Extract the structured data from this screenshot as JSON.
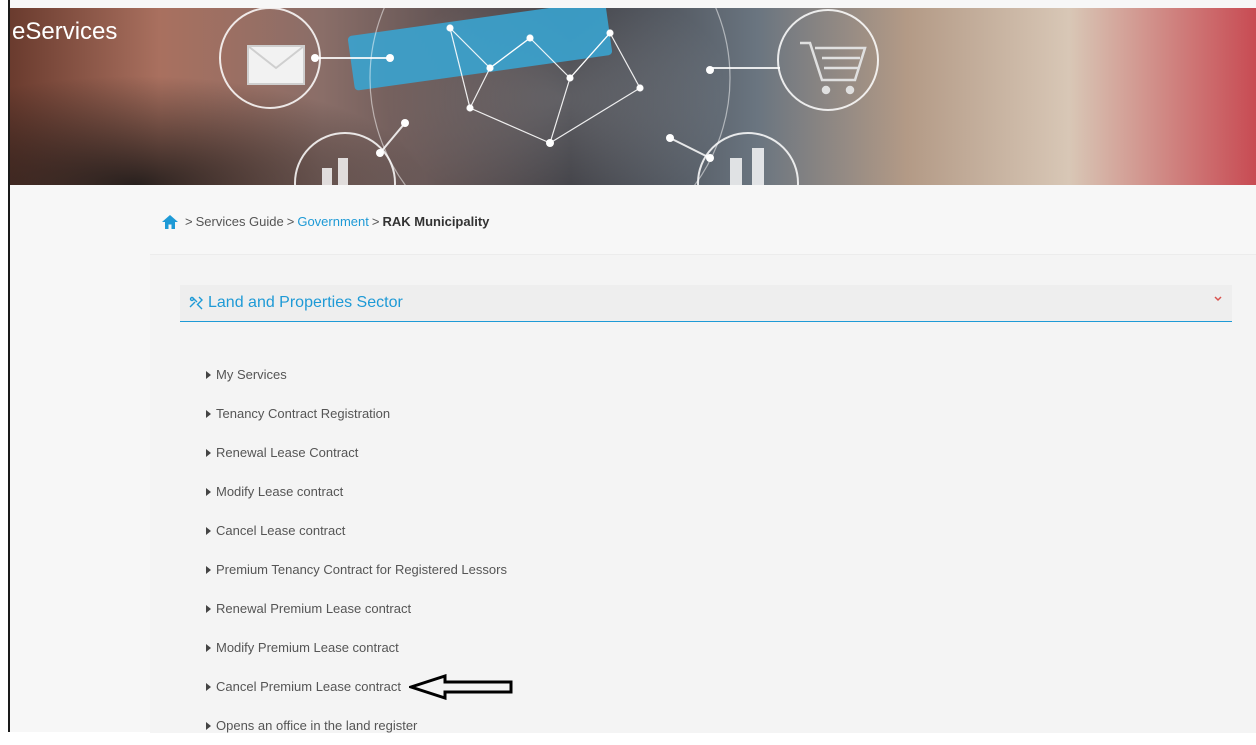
{
  "banner": {
    "title": "eServices"
  },
  "breadcrumb": {
    "items": [
      {
        "label": "Services Guide"
      },
      {
        "label": "Government"
      },
      {
        "label": "RAK Municipality"
      }
    ]
  },
  "sector": {
    "title": "Land and Properties Sector"
  },
  "services": [
    "My Services",
    "Tenancy Contract Registration",
    "Renewal Lease Contract",
    "Modify Lease contract",
    "Cancel Lease contract",
    "Premium Tenancy Contract for Registered Lessors",
    "Renewal Premium Lease contract",
    "Modify Premium Lease contract",
    "Cancel Premium Lease contract",
    "Opens an office in the land register"
  ],
  "colors": {
    "accent": "#1e9ad6",
    "chevron": "#d9534f"
  }
}
